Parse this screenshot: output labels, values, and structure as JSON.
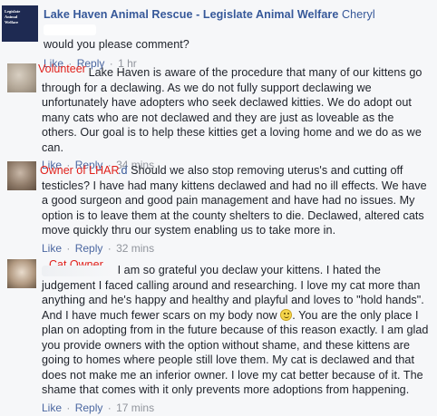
{
  "comments": [
    {
      "author": "Lake Haven Animal Rescue - Legislate Animal Welfare",
      "author_partial": "Cheryl",
      "text": "would you please comment?",
      "like": "Like",
      "reply": "Reply",
      "time": "1 hr",
      "logo_lines": [
        "Legislate",
        "Animal",
        "Welfare"
      ]
    },
    {
      "annotation": "Volunteer",
      "text": "Lake Haven is aware of the procedure that many of our kittens go through for a declawing. As we do not fully support declawing we unfortunately have adopters who seek declawed kitties. We do adopt out many cats who are not declawed and they are just as loveable as the others. Our goal is to help these kitties get a loving home and we do as we can.",
      "like": "Like",
      "reply": "Reply",
      "time": "34 mins"
    },
    {
      "annotation": "Owner of LHAR",
      "text_prefix": ".d",
      "text": "Should we also stop removing uterus's and cutting off testicles? I have had many kittens declawed and had no ill effects. We have a good surgeon and good pain management and have had no issues. My option is to leave them at the county shelters to die. Declawed, altered cats move quickly thru our system enabling us to take more in.",
      "like": "Like",
      "reply": "Reply",
      "time": "32 mins"
    },
    {
      "annotation": "Cat Owner",
      "text_a": "I am so grateful you declaw your kittens. I hated the judgement I faced calling around and researching. I love my cat more than anything and he's happy and healthy and playful and loves to \"hold hands\". And I have much fewer scars on my body now",
      "text_b": ". You are the only place I plan on adopting from in the future because of this reason exactly. I am glad you provide owners with the option without shame, and these kittens are going to homes where people still love them. My cat is declawed and that does not make me an inferior owner. I love my cat better because of it. The shame that comes with it only prevents more adoptions from happening.",
      "like": "Like",
      "reply": "Reply",
      "time": "17 mins"
    }
  ],
  "icons": {
    "smile": "smile-emoji-icon"
  },
  "colors": {
    "link": "#4b67a1",
    "author": "#365899",
    "annotation": "#e0201b",
    "meta": "#90949c"
  }
}
